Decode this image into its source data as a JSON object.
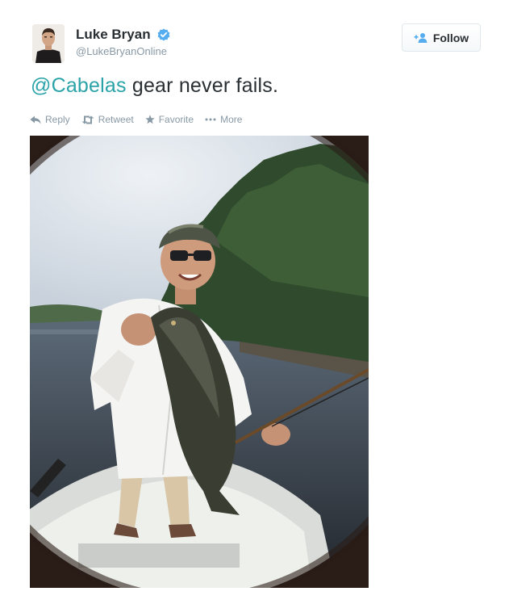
{
  "author": {
    "name": "Luke Bryan",
    "handle": "@LukeBryanOnline",
    "verified": true
  },
  "follow_button": {
    "label": "Follow",
    "icon": "add-user-icon"
  },
  "tweet": {
    "mention": "@Cabelas",
    "text": " gear never fails."
  },
  "actions": [
    {
      "label": "Reply",
      "icon": "reply-icon"
    },
    {
      "label": "Retweet",
      "icon": "retweet-icon"
    },
    {
      "label": "Favorite",
      "icon": "star-icon"
    },
    {
      "label": "More",
      "icon": "more-dots-icon"
    }
  ],
  "colors": {
    "text": "#292f33",
    "mention": "#2aa3a8",
    "meta": "#8899a6",
    "verified": "#55acee"
  }
}
